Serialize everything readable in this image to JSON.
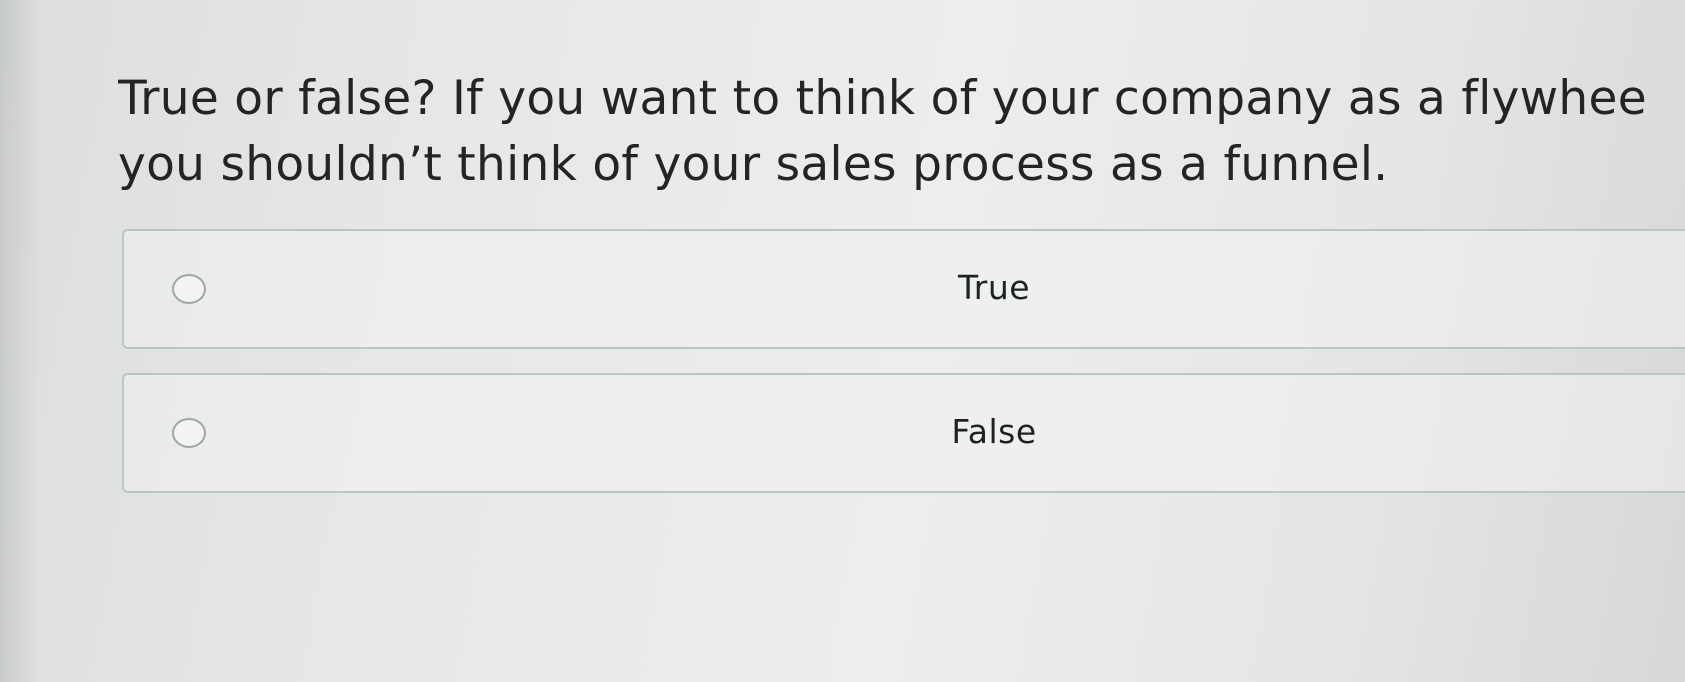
{
  "question": {
    "line1": "True or false? If you want to think of your company as a flywhee",
    "line2": "you shouldn’t think of your sales process as a funnel."
  },
  "options": [
    {
      "label": "True",
      "selected": false
    },
    {
      "label": "False",
      "selected": false
    }
  ]
}
